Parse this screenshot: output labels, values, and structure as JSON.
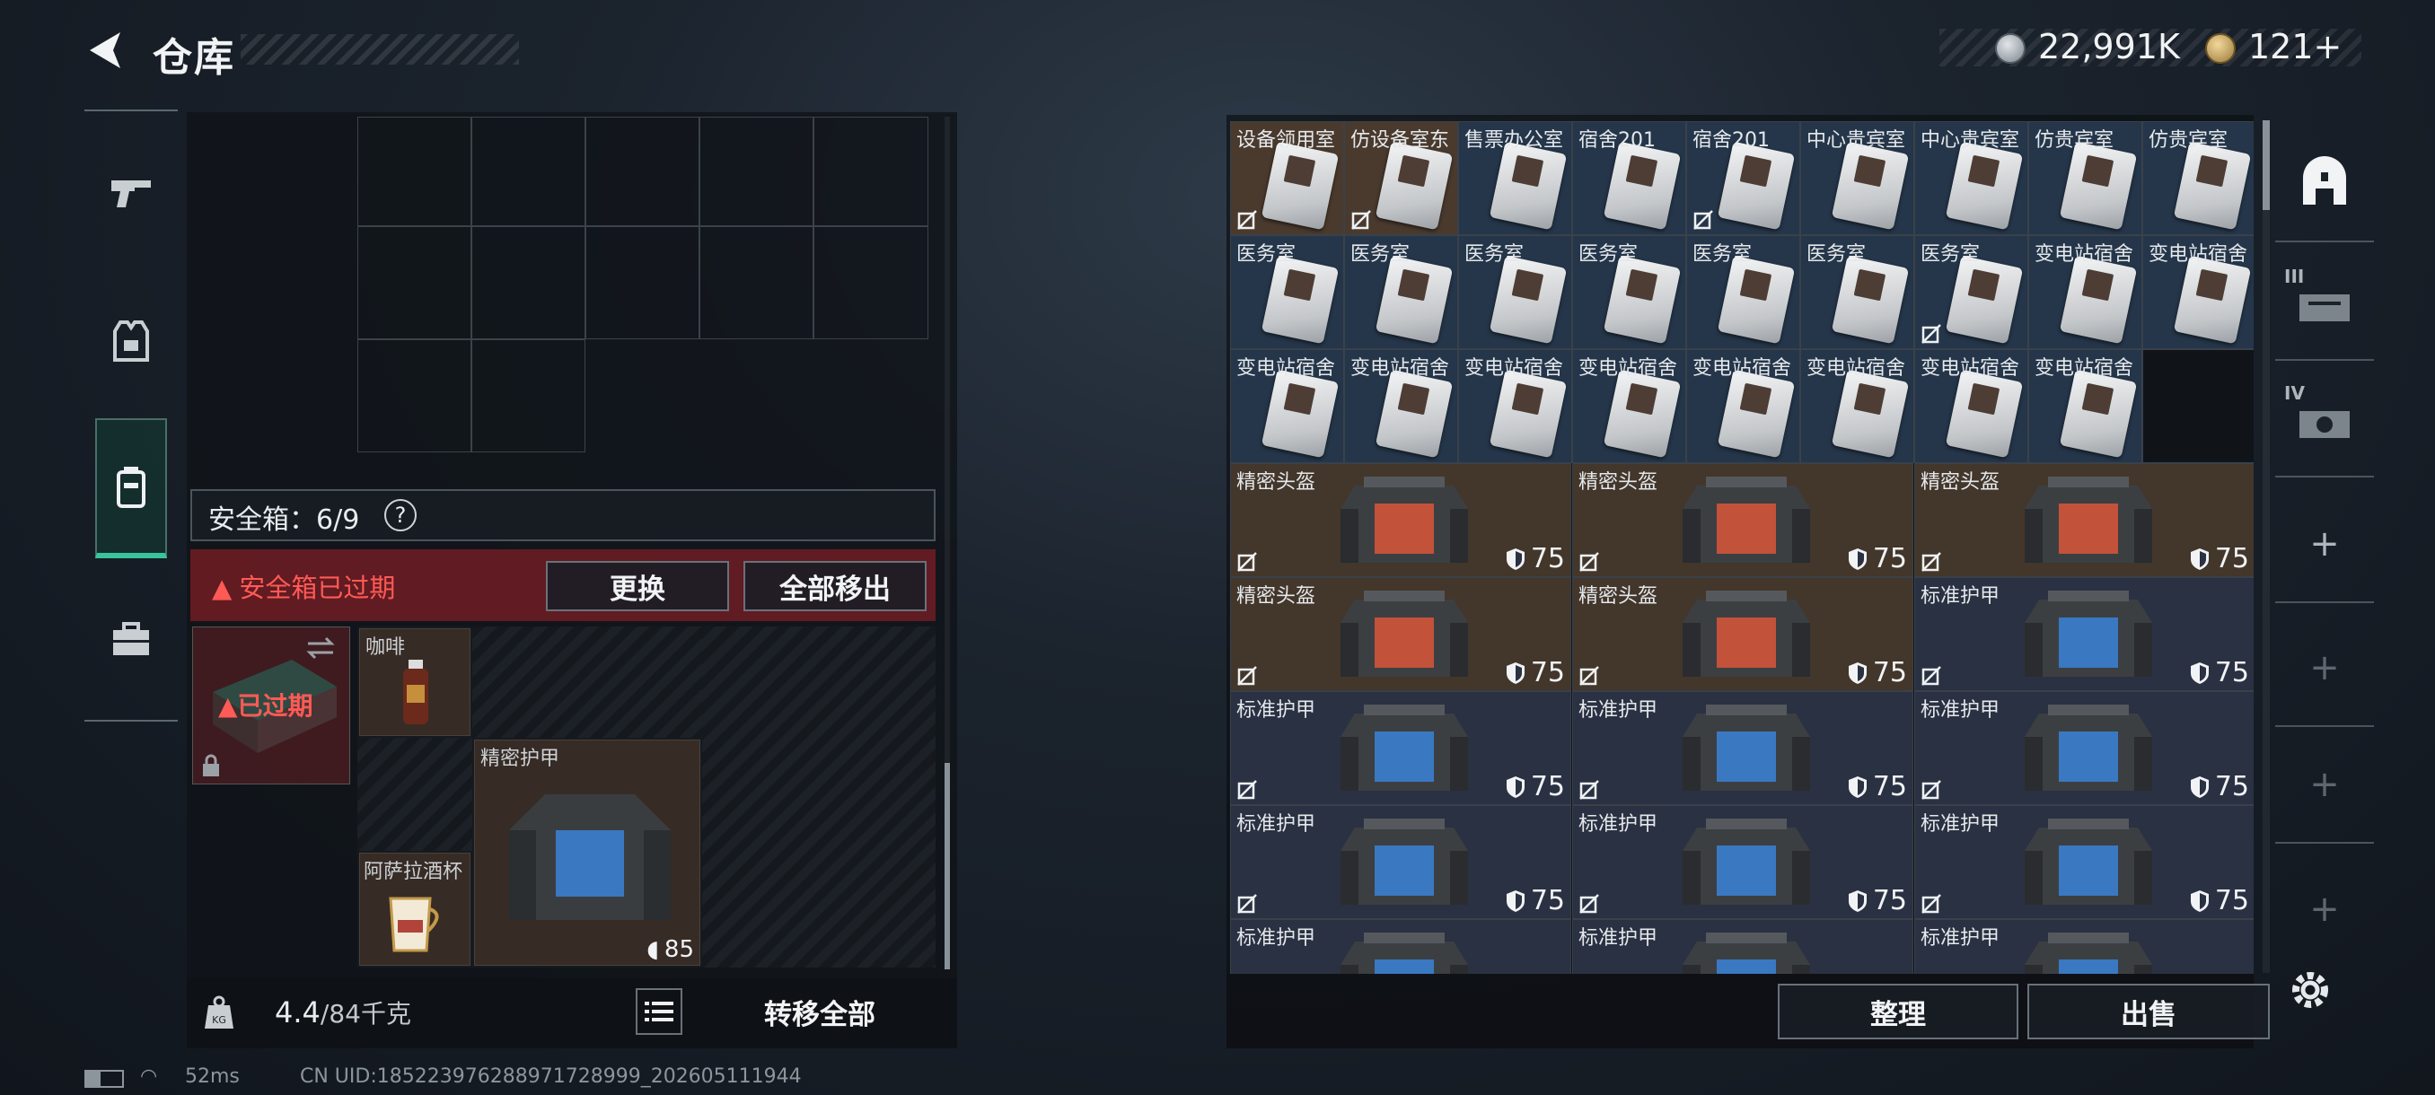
{
  "header": {
    "title": "仓库"
  },
  "currency": [
    {
      "value": "22,991K",
      "icon": "silver-coin-icon"
    },
    {
      "value": "121+",
      "icon": "gold-coin-icon"
    }
  ],
  "left": {
    "safebox_label": "安全箱：6/9",
    "help": "?",
    "expired_warning": "安全箱已过期",
    "replace_button": "更换",
    "move_all_out_button": "全部移出",
    "case_status": "已过期",
    "items": [
      {
        "name": "咖啡"
      },
      {
        "name": "精密护甲",
        "durability": "85"
      },
      {
        "name": "阿萨拉酒杯"
      }
    ],
    "weight_current": "4.4",
    "weight_max": "/84千克",
    "transfer_all_button": "转移全部"
  },
  "status_bar": {
    "ping": "52ms",
    "uid": "CN UID:185223976288971728999_202605111944"
  },
  "right": {
    "card_rows": [
      [
        "设备领用室",
        "仿设备室东",
        "售票办公室",
        "宿舍201",
        "宿舍201",
        "中心贵宾室",
        "中心贵宾室",
        "仿贵宾室",
        "仿贵宾室"
      ],
      [
        "医务室",
        "医务室",
        "医务室",
        "医务室",
        "医务室",
        "医务室",
        "医务室",
        "变电站宿舍",
        "变电站宿舍"
      ],
      [
        "变电站宿舍",
        "变电站宿舍",
        "变电站宿舍",
        "变电站宿舍",
        "变电站宿舍",
        "变电站宿舍",
        "变电站宿舍",
        "变电站宿舍"
      ]
    ],
    "armor_rows": [
      [
        {
          "name": "精密头盔",
          "value": "75"
        },
        {
          "name": "精密头盔",
          "value": "75"
        },
        {
          "name": "精密头盔",
          "value": "75"
        }
      ],
      [
        {
          "name": "精密头盔",
          "value": "75"
        },
        {
          "name": "精密头盔",
          "value": "75"
        },
        {
          "name": "标准护甲",
          "value": "75"
        }
      ],
      [
        {
          "name": "标准护甲",
          "value": "75"
        },
        {
          "name": "标准护甲",
          "value": "75"
        },
        {
          "name": "标准护甲",
          "value": "75"
        }
      ],
      [
        {
          "name": "标准护甲",
          "value": "75"
        },
        {
          "name": "标准护甲",
          "value": "75"
        },
        {
          "name": "标准护甲",
          "value": "75"
        }
      ],
      [
        {
          "name": "标准护甲",
          "value": ""
        },
        {
          "name": "标准护甲",
          "value": ""
        },
        {
          "name": "标准护甲",
          "value": ""
        }
      ]
    ],
    "sort_button": "整理",
    "sell_button": "出售",
    "side_tabs": [
      "III",
      "IV"
    ],
    "add": "+"
  },
  "colors": {
    "accent": "#39c59a",
    "warning": "#ff5a55",
    "card_brown": "#4a3a2e",
    "card_blue": "#25364a"
  }
}
